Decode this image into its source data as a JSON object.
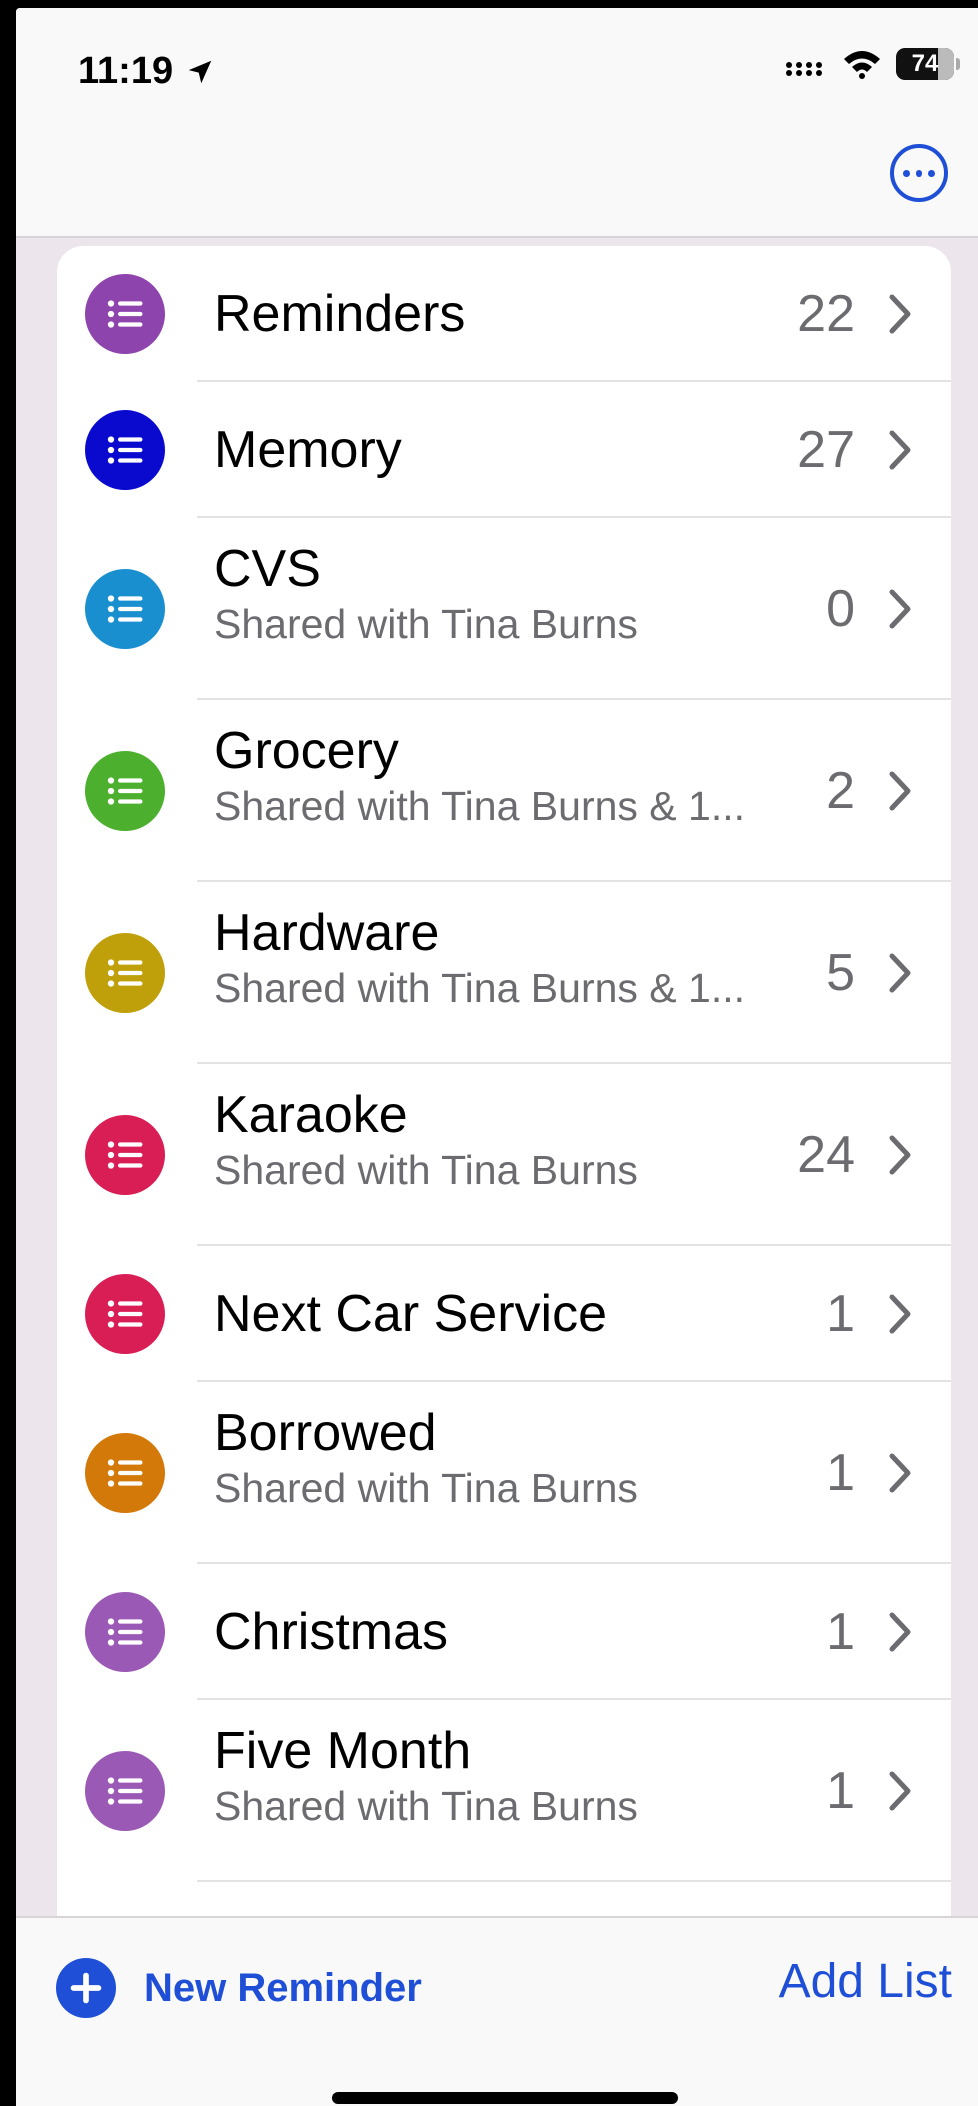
{
  "status": {
    "time": "11:19",
    "battery": "74"
  },
  "lists": [
    {
      "title": "Reminders",
      "subtitle": "",
      "count": "22",
      "color": "#8E44AD"
    },
    {
      "title": "Memory",
      "subtitle": "",
      "count": "27",
      "color": "#0A0ACF"
    },
    {
      "title": "CVS",
      "subtitle": "Shared with Tina Burns",
      "count": "0",
      "color": "#1A8FD0"
    },
    {
      "title": "Grocery",
      "subtitle": "Shared with Tina Burns & 1...",
      "count": "2",
      "color": "#4CAF2E"
    },
    {
      "title": "Hardware",
      "subtitle": "Shared with Tina Burns & 1...",
      "count": "5",
      "color": "#BFA00A"
    },
    {
      "title": "Karaoke",
      "subtitle": "Shared with Tina Burns",
      "count": "24",
      "color": "#D81E55"
    },
    {
      "title": "Next Car Service",
      "subtitle": "",
      "count": "1",
      "color": "#D81E55"
    },
    {
      "title": "Borrowed",
      "subtitle": "Shared with Tina Burns",
      "count": "1",
      "color": "#D2790A"
    },
    {
      "title": "Christmas",
      "subtitle": "",
      "count": "1",
      "color": "#9B59B6"
    },
    {
      "title": "Five Month",
      "subtitle": "Shared with Tina Burns",
      "count": "1",
      "color": "#9B59B6"
    }
  ],
  "toolbar": {
    "new_reminder": "New Reminder",
    "add_list": "Add List"
  },
  "colors": {
    "accent": "#1E4FD6"
  }
}
